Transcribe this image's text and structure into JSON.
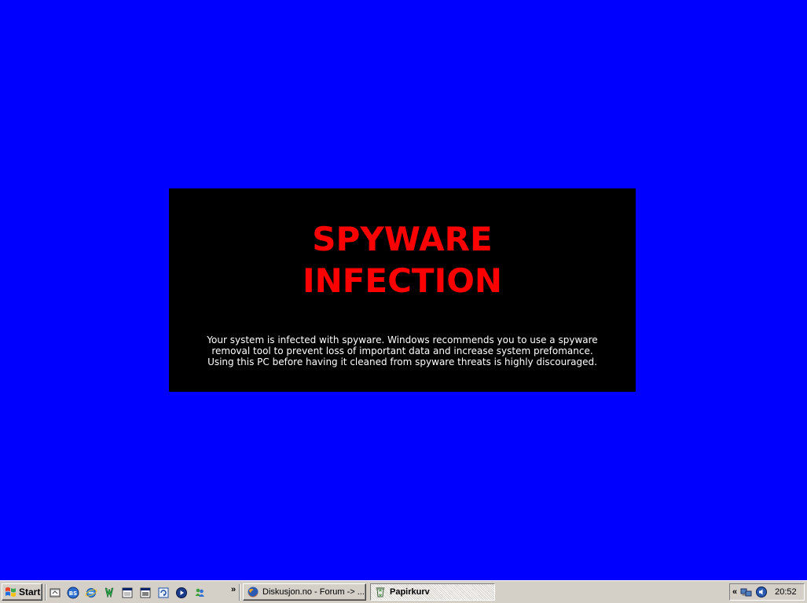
{
  "warning": {
    "title": "SPYWARE\nINFECTION",
    "message_lines": [
      "Your system is infected with spyware. Windows recommends you to use a spyware",
      "removal tool to prevent loss of important data and increase system prefomance.",
      "Using this PC before having it cleaned from spyware threats is highly discouraged."
    ]
  },
  "taskbar": {
    "start_label": "Start",
    "quick_launch_icons": [
      "show-desktop-icon",
      "bs-player-icon",
      "internet-explorer-icon",
      "winamp-icon",
      "window-icon",
      "window-icon",
      "refresh-icon",
      "media-player-icon",
      "messenger-icon"
    ],
    "quick_launch_chevron": "»",
    "tasks": [
      {
        "label": "Diskusjon.no - Forum -> ...",
        "icon": "firefox-icon",
        "active": false
      },
      {
        "label": "Papirkurv",
        "icon": "recycle-bin-icon",
        "active": true
      }
    ],
    "tray": {
      "chevron": "«",
      "icons": [
        "network-icon",
        "volume-icon"
      ],
      "clock": "20:52"
    }
  },
  "colors": {
    "desktop": "#0000FF",
    "warning_bg": "#000000",
    "warning_title": "#FF0000",
    "warning_text": "#FFFFFF",
    "taskbar": "#D4D0C8"
  }
}
